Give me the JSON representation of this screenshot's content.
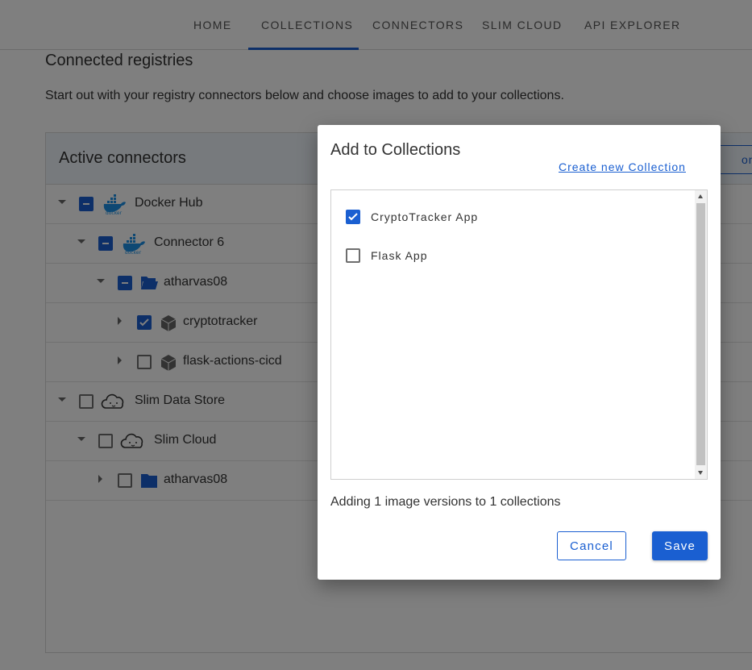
{
  "nav": {
    "items": [
      {
        "label": "HOME",
        "active": false
      },
      {
        "label": "COLLECTIONS",
        "active": true
      },
      {
        "label": "CONNECTORS",
        "active": false
      },
      {
        "label": "SLIM CLOUD",
        "active": false
      },
      {
        "label": "API EXPLORER",
        "active": false
      }
    ]
  },
  "page": {
    "title": "Connected registries",
    "description": "Start out with your registry connectors below and choose images to add to your collections."
  },
  "panel": {
    "title": "Active connectors",
    "header_button_visible_text": "ons",
    "tree": [
      {
        "label": "Docker Hub",
        "state": "indeterminate",
        "icon": "docker-icon",
        "expanded": true
      },
      {
        "label": "Connector 6",
        "state": "indeterminate",
        "icon": "docker-icon",
        "expanded": true
      },
      {
        "label": "atharvas08",
        "state": "indeterminate",
        "icon": "folder-open-icon",
        "expanded": true
      },
      {
        "label": "cryptotracker",
        "state": "checked",
        "icon": "package-icon",
        "expanded": false
      },
      {
        "label": "flask-actions-cicd",
        "state": "unchecked",
        "icon": "package-icon",
        "expanded": false
      },
      {
        "label": "Slim Data Store",
        "state": "unchecked",
        "icon": "cloud-face-icon",
        "expanded": true
      },
      {
        "label": "Slim Cloud",
        "state": "unchecked",
        "icon": "cloud-face-icon",
        "expanded": true
      },
      {
        "label": "atharvas08",
        "state": "unchecked",
        "icon": "folder-icon",
        "expanded": false
      }
    ]
  },
  "dialog": {
    "title": "Add to Collections",
    "create_link": "Create new Collection",
    "collections": [
      {
        "label": "CryptoTracker App",
        "checked": true
      },
      {
        "label": "Flask App",
        "checked": false
      }
    ],
    "status": "Adding 1 image versions to 1 collections",
    "cancel_label": "Cancel",
    "save_label": "Save"
  },
  "colors": {
    "accent": "#1a5fd1",
    "docker_blue": "#1d91e6",
    "folder_blue": "#1a5fd1"
  }
}
